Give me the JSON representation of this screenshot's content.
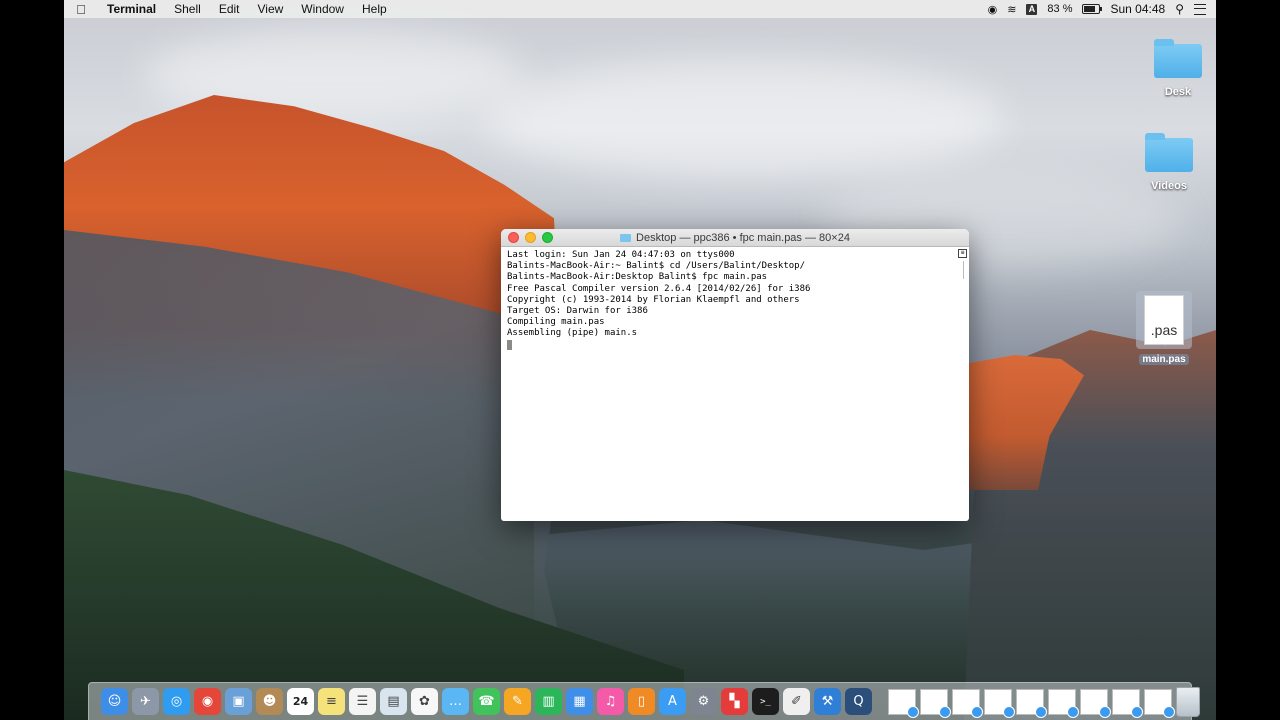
{
  "menubar": {
    "app_name": "Terminal",
    "items": [
      "Shell",
      "Edit",
      "View",
      "Window",
      "Help"
    ],
    "battery": "83 %",
    "battery_level": 0.83,
    "input_source": "A",
    "clock": "Sun 04:48"
  },
  "desktop": {
    "icons": [
      {
        "label": "Desk",
        "type": "folder"
      },
      {
        "label": "Videos",
        "type": "folder"
      },
      {
        "label": "main.pas",
        "type": "file",
        "ext": ".pas"
      }
    ]
  },
  "terminal": {
    "title": "Desktop — ppc386 • fpc main.pas — 80×24",
    "lines": [
      "Last login: Sun Jan 24 04:47:03 on ttys000",
      "Balints-MacBook-Air:~ Balint$ cd /Users/Balint/Desktop/",
      "Balints-MacBook-Air:Desktop Balint$ fpc main.pas",
      "Free Pascal Compiler version 2.6.4 [2014/02/26] for i386",
      "Copyright (c) 1993-2014 by Florian Klaempfl and others",
      "Target OS: Darwin for i386",
      "Compiling main.pas",
      "Assembling (pipe) main.s"
    ]
  },
  "dock": {
    "apps": [
      {
        "name": "finder-icon",
        "color": "#3e8ee8",
        "glyph": "☺"
      },
      {
        "name": "launchpad-icon",
        "color": "#8c98a8",
        "glyph": "✈"
      },
      {
        "name": "safari-icon",
        "color": "#2f9cf0",
        "glyph": "◎"
      },
      {
        "name": "chrome-icon",
        "color": "#e4463a",
        "glyph": "◉"
      },
      {
        "name": "preview-icon",
        "color": "#6aa0d8",
        "glyph": "▣"
      },
      {
        "name": "contacts-icon",
        "color": "#b28a55",
        "glyph": "☻"
      },
      {
        "name": "calendar-icon",
        "color": "#ffffff",
        "glyph": "24"
      },
      {
        "name": "notes-icon",
        "color": "#f6e27a",
        "glyph": "≡"
      },
      {
        "name": "reminders-icon",
        "color": "#f4f4f4",
        "glyph": "☰"
      },
      {
        "name": "photo-booth-icon",
        "color": "#d8e4ee",
        "glyph": "▤"
      },
      {
        "name": "photos-icon",
        "color": "#f7f7f7",
        "glyph": "✿"
      },
      {
        "name": "messages-icon",
        "color": "#5bb6f4",
        "glyph": "…"
      },
      {
        "name": "facetime-icon",
        "color": "#3fc35a",
        "glyph": "☎"
      },
      {
        "name": "pages-icon",
        "color": "#f5a623",
        "glyph": "✎"
      },
      {
        "name": "numbers-icon",
        "color": "#2bb65a",
        "glyph": "▥"
      },
      {
        "name": "keynote-icon",
        "color": "#3f8ee8",
        "glyph": "▦"
      },
      {
        "name": "itunes-icon",
        "color": "#f45aa8",
        "glyph": "♫"
      },
      {
        "name": "ibooks-icon",
        "color": "#f08a24",
        "glyph": "▯"
      },
      {
        "name": "app-store-icon",
        "color": "#3a9cf2",
        "glyph": "A"
      },
      {
        "name": "system-preferences-icon",
        "color": "#7d8590",
        "glyph": "⚙"
      },
      {
        "name": "multicolor-app-icon",
        "color": "#e43b3b",
        "glyph": "▚"
      },
      {
        "name": "terminal-icon",
        "color": "#1d1d1d",
        "glyph": ">_"
      },
      {
        "name": "script-editor-icon",
        "color": "#efefef",
        "glyph": "✐"
      },
      {
        "name": "xcode-icon",
        "color": "#2f7fd6",
        "glyph": "⚒"
      },
      {
        "name": "quicktime-icon",
        "color": "#2b4f7a",
        "glyph": "Q"
      }
    ],
    "documents": 9
  }
}
